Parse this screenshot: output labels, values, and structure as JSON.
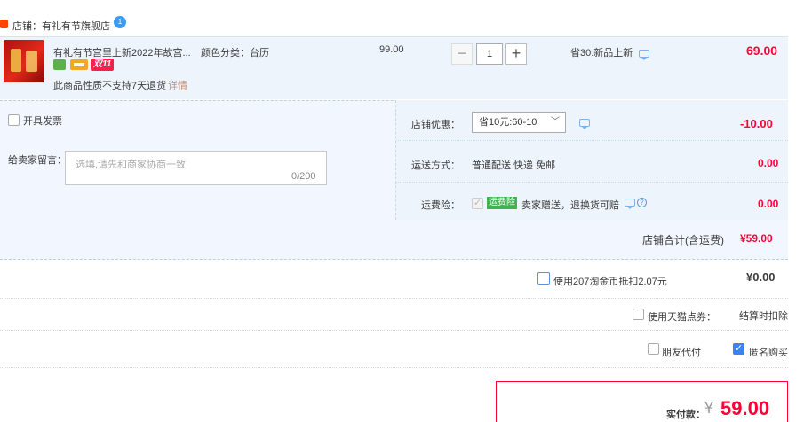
{
  "shop": {
    "label": "店铺：有礼有节旗舰店",
    "badge_count": "1"
  },
  "item": {
    "title": "有礼有节宫里上新2022年故宫...",
    "spec": "颜色分类：台历",
    "price": "99.00",
    "quantity": "1",
    "minus": "−",
    "plus": "+",
    "promo": "省30:新品上新",
    "subtotal": "69.00",
    "badge_double11": "双11",
    "no_return": "此商品性质不支持7天退货",
    "detail_link": "详情"
  },
  "options": {
    "invoice_label": "开具发票",
    "message_label": "给卖家留言：",
    "message_placeholder": "选填,请先和商家协商一致",
    "message_count": "0/200",
    "coupon_label": "店铺优惠：",
    "coupon_value": "省10元:60-10",
    "coupon_amount": "-10.00",
    "ship_label": "运送方式：",
    "ship_option": "普通配送 快递 免邮",
    "ship_amount": "0.00",
    "insurance_label": "运费险：",
    "insurance_tag": "运费险",
    "insurance_text": "卖家赠送，退换货可赔",
    "insurance_amount": "0.00",
    "shop_total_label": "店铺合计(含运费)",
    "shop_total": "¥59.00"
  },
  "checkout": {
    "coin_label": "使用207淘金币抵扣2.07元",
    "coin_amount": "¥0.00",
    "tmall_points_label": "使用天猫点券：",
    "tmall_points_value": "结算时扣除",
    "friend_pay_label": "朋友代付",
    "anonymous_label": "匿名购买",
    "anonymous_checked": true,
    "pay_label": "实付款：",
    "pay_currency": "¥",
    "pay_amount": "59.00"
  },
  "colors": {
    "accent_red": "#ff0036",
    "panel_blue": "#eef4fc",
    "insurance_green": "#3fb34f",
    "checkbox_blue": "#3d82f0"
  }
}
